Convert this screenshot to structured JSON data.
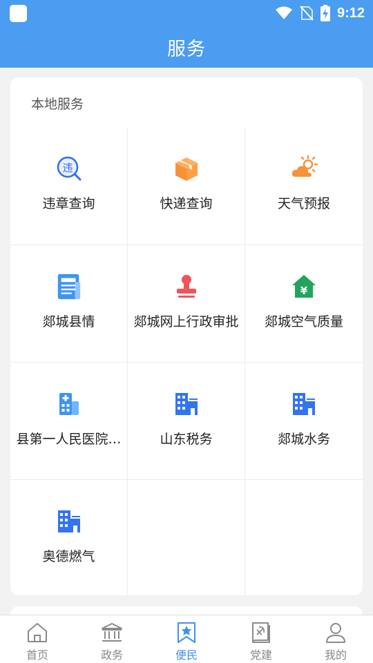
{
  "status_bar": {
    "time": "9:12"
  },
  "header": {
    "title": "服务"
  },
  "local_services": {
    "title": "本地服务",
    "items": [
      {
        "label": "违章查询",
        "icon": "violation-search-icon"
      },
      {
        "label": "快递查询",
        "icon": "package-icon"
      },
      {
        "label": "天气预报",
        "icon": "weather-icon"
      },
      {
        "label": "郯城县情",
        "icon": "news-doc-icon"
      },
      {
        "label": "郯城网上行政审批",
        "icon": "stamp-icon"
      },
      {
        "label": "郯城空气质量",
        "icon": "house-yen-icon"
      },
      {
        "label": "县第一人民医院…",
        "icon": "hospital-icon"
      },
      {
        "label": "山东税务",
        "icon": "building-icon"
      },
      {
        "label": "郯城水务",
        "icon": "building-icon"
      },
      {
        "label": "奥德燃气",
        "icon": "building-icon"
      }
    ]
  },
  "tabs": [
    {
      "label": "首页",
      "icon": "home-icon"
    },
    {
      "label": "政务",
      "icon": "government-icon"
    },
    {
      "label": "便民",
      "icon": "bookmark-star-icon",
      "active": true
    },
    {
      "label": "党建",
      "icon": "party-book-icon"
    },
    {
      "label": "我的",
      "icon": "user-icon"
    }
  ],
  "colors": {
    "primary": "#4a9df0",
    "active_tab": "#3f8ff0"
  }
}
